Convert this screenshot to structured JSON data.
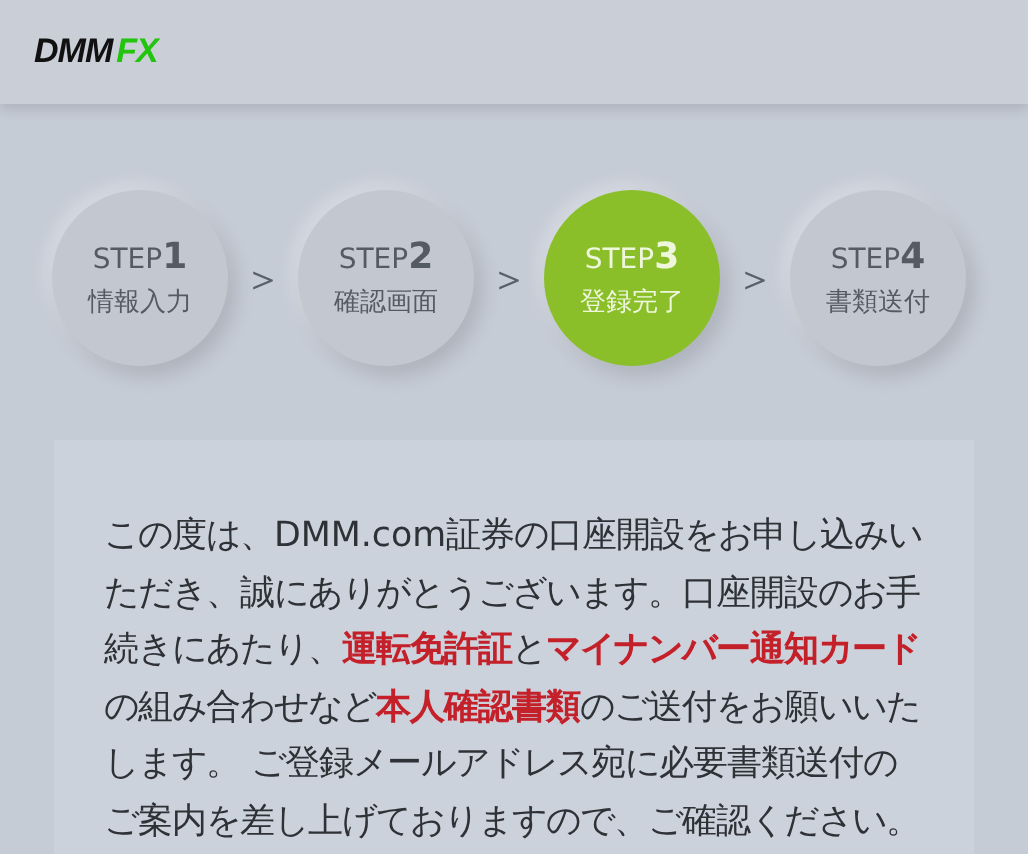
{
  "header": {
    "logo": {
      "brand": "DMM",
      "product": "FX"
    }
  },
  "steps": [
    {
      "label": "STEP",
      "number": "1",
      "name": "情報入力",
      "selected": false
    },
    {
      "label": "STEP",
      "number": "2",
      "name": "確認画面",
      "selected": false
    },
    {
      "label": "STEP",
      "number": "3",
      "name": "登録完了",
      "selected": true
    },
    {
      "label": "STEP",
      "number": "4",
      "name": "書類送付",
      "selected": false
    }
  ],
  "separators": [
    "＞",
    "＞",
    "＞"
  ],
  "message": "この度は、DMM.com証券の口座開設をお申し込みいただき、誠にありがとうございます。口座開設のお手続きにあたり、**運転免許証**と**マイナンバー通知カード**の組み合わせなど**本人確認書類**のご送付をお願いいたします。 ご登録メールアドレス宛に必要書類送付のご案内を差し上げておりますので、ご確認ください。"
}
